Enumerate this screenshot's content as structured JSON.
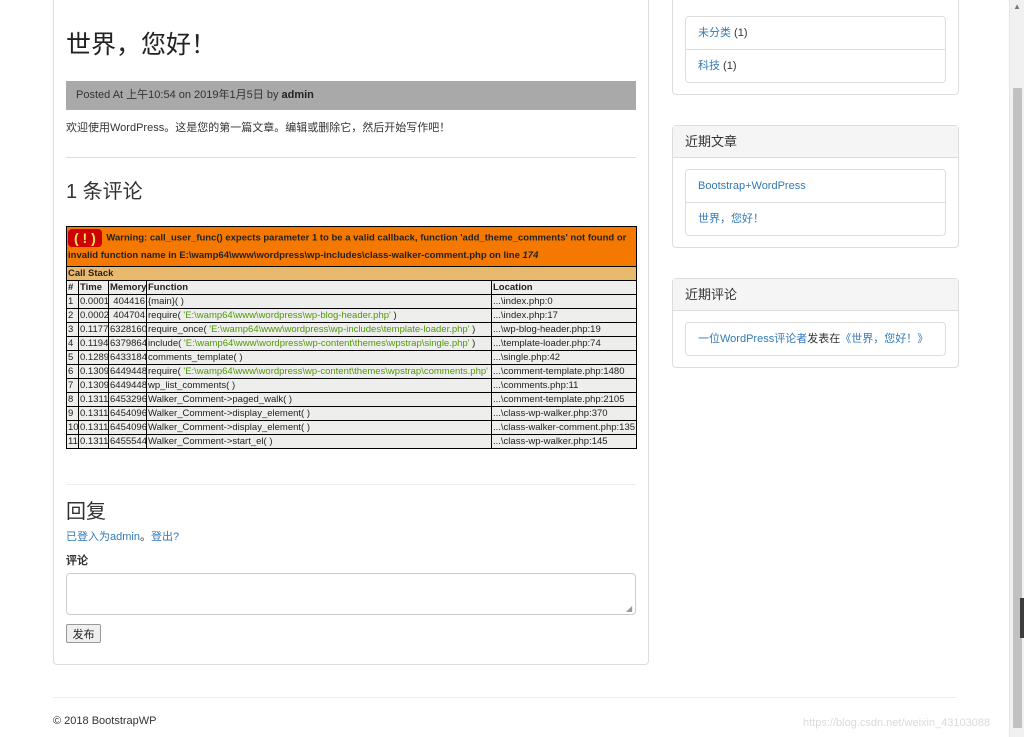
{
  "post": {
    "title": "世界，您好！",
    "meta_prefix": "Posted At ",
    "meta_time": "上午10:54",
    "meta_on": " on ",
    "meta_date": "2019年1月5日",
    "meta_by": " by ",
    "meta_author": "admin",
    "excerpt": "欢迎使用WordPress。这是您的第一篇文章。编辑或删除它，然后开始写作吧！"
  },
  "comments": {
    "title": "1 条评论"
  },
  "xdebug": {
    "icon": "( ! )",
    "warning_text": "Warning: call_user_func() expects parameter 1 to be a valid callback, function 'add_theme_comments' not found or invalid function name in E:\\wamp64\\www\\wordpress\\wp-includes\\class-walker-comment.php on line ",
    "warning_line": "174",
    "call_stack_label": "Call Stack",
    "headers": [
      "#",
      "Time",
      "Memory",
      "Function",
      "Location"
    ],
    "rows": [
      {
        "n": "1",
        "time": "0.0001",
        "mem": "404416",
        "fn": "{main}( )",
        "arg": "",
        "fn_end": "",
        "loc": "...\\index.php:0"
      },
      {
        "n": "2",
        "time": "0.0002",
        "mem": "404704",
        "fn": "require( ",
        "arg": "'E:\\wamp64\\www\\wordpress\\wp-blog-header.php'",
        "fn_end": " )",
        "loc": "...\\index.php:17"
      },
      {
        "n": "3",
        "time": "0.1177",
        "mem": "6328160",
        "fn": "require_once( ",
        "arg": "'E:\\wamp64\\www\\wordpress\\wp-includes\\template-loader.php'",
        "fn_end": " )",
        "loc": "...\\wp-blog-header.php:19"
      },
      {
        "n": "4",
        "time": "0.1194",
        "mem": "6379864",
        "fn": "include( ",
        "arg": "'E:\\wamp64\\www\\wordpress\\wp-content\\themes\\wpstrap\\single.php'",
        "fn_end": " )",
        "loc": "...\\template-loader.php:74"
      },
      {
        "n": "5",
        "time": "0.1289",
        "mem": "6433184",
        "fn": "comments_template( )",
        "arg": "",
        "fn_end": "",
        "loc": "...\\single.php:42"
      },
      {
        "n": "6",
        "time": "0.1309",
        "mem": "6449448",
        "fn": "require( ",
        "arg": "'E:\\wamp64\\www\\wordpress\\wp-content\\themes\\wpstrap\\comments.php'",
        "fn_end": " )",
        "loc": "...\\comment-template.php:1480"
      },
      {
        "n": "7",
        "time": "0.1309",
        "mem": "6449448",
        "fn": "wp_list_comments( )",
        "arg": "",
        "fn_end": "",
        "loc": "...\\comments.php:11"
      },
      {
        "n": "8",
        "time": "0.1311",
        "mem": "6453296",
        "fn": "Walker_Comment->paged_walk( )",
        "arg": "",
        "fn_end": "",
        "loc": "...\\comment-template.php:2105"
      },
      {
        "n": "9",
        "time": "0.1311",
        "mem": "6454096",
        "fn": "Walker_Comment->display_element( )",
        "arg": "",
        "fn_end": "",
        "loc": "...\\class-wp-walker.php:370"
      },
      {
        "n": "10",
        "time": "0.1311",
        "mem": "6454096",
        "fn": "Walker_Comment->display_element( )",
        "arg": "",
        "fn_end": "",
        "loc": "...\\class-walker-comment.php:135"
      },
      {
        "n": "11",
        "time": "0.1311",
        "mem": "6455544",
        "fn": "Walker_Comment->start_el( )",
        "arg": "",
        "fn_end": "",
        "loc": "...\\class-wp-walker.php:145"
      }
    ]
  },
  "reply": {
    "title": "回复",
    "logged_in_link": "已登入为admin",
    "separator": "。",
    "logout_link": "登出?",
    "comment_label": "评论",
    "submit_label": "发布"
  },
  "sidebar": {
    "categories": [
      {
        "label": "未分类",
        "count": " (1)"
      },
      {
        "label": "科技",
        "count": " (1)"
      }
    ],
    "recent_posts": {
      "title": "近期文章",
      "items": [
        "Bootstrap+WordPress",
        "世界，您好！"
      ]
    },
    "recent_comments": {
      "title": "近期评论",
      "author": "一位WordPress评论者",
      "middle": "发表在",
      "post": "《世界，您好！》"
    }
  },
  "footer": {
    "copyright": "© 2018 BootstrapWP",
    "watermark": "https://blog.csdn.net/weixin_43103088"
  },
  "colors": {
    "xdebug_warning_bg": "#f57900",
    "xdebug_callstack_bg": "#e9b96e",
    "xdebug_row_bg": "#eeeeec",
    "xdebug_arg_green": "#4e9a06",
    "link": "#337ab7",
    "meta_bar_bg": "#a9a9a9"
  }
}
